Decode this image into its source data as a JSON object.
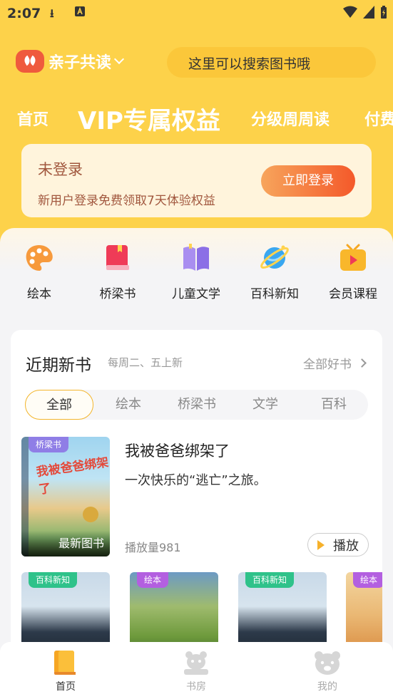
{
  "status_bar": {
    "time": "2:07"
  },
  "header": {
    "app_name": "亲子共读",
    "search_placeholder": "这里可以搜索图书哦"
  },
  "nav_tabs": [
    {
      "label": "首页"
    },
    {
      "label": "VIP专属权益"
    },
    {
      "label": "分级周周读"
    },
    {
      "label": "付费"
    }
  ],
  "login_card": {
    "title": "未登录",
    "subtitle": "新用户登录免费领取7天体验权益",
    "button": "立即登录"
  },
  "categories": [
    {
      "label": "绘本",
      "icon": "palette-icon"
    },
    {
      "label": "桥梁书",
      "icon": "book-icon"
    },
    {
      "label": "儿童文学",
      "icon": "open-book-icon"
    },
    {
      "label": "百科新知",
      "icon": "planet-icon"
    },
    {
      "label": "会员课程",
      "icon": "tv-play-icon"
    }
  ],
  "new_books": {
    "title": "近期新书",
    "subtitle": "每周二、五上新",
    "more": "全部好书",
    "filters": [
      "全部",
      "绘本",
      "桥梁书",
      "文学",
      "百科"
    ],
    "featured": {
      "tag": "桥梁书",
      "cover_title": "我被爸爸绑架了",
      "overlay": "最新图书",
      "title": "我被爸爸绑架了",
      "description": "一次快乐的“逃亡”之旅。",
      "plays": "播放量981",
      "play_button": "播放"
    },
    "thumbnails": [
      {
        "tag": "百科新知",
        "tag_color": "#2fc28a"
      },
      {
        "tag": "绘本",
        "tag_color": "#b35fe0"
      },
      {
        "tag": "百科新知",
        "tag_color": "#2fc28a"
      },
      {
        "tag": "绘本",
        "tag_color": "#b35fe0"
      }
    ]
  },
  "tabbar": [
    {
      "label": "首页",
      "icon": "bookshelf-icon",
      "active": true
    },
    {
      "label": "书房",
      "icon": "bear-icon",
      "active": false
    },
    {
      "label": "我的",
      "icon": "bear-face-icon",
      "active": false
    }
  ],
  "colors": {
    "brand_yellow": "#fdd24a",
    "login_gradient_start": "#f7a55c",
    "login_gradient_end": "#f4592a"
  }
}
